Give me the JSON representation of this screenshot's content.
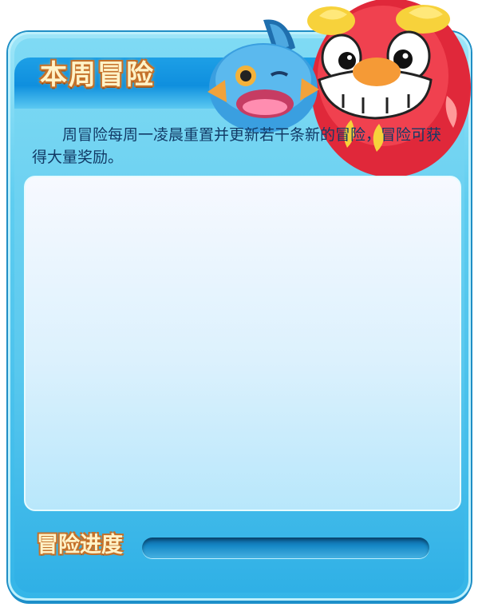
{
  "panel": {
    "title": "本周冒险",
    "description": "周冒险每周一凌晨重置并更新若干条新的冒险，冒险可获得大量奖励。"
  },
  "progress": {
    "label": "冒险进度",
    "value": 0
  },
  "mascots": {
    "left": "blue-fish-mascot",
    "right": "red-round-mascot"
  },
  "colors": {
    "panel_blue": "#34b5e8",
    "header_blue": "#0f8fde",
    "title_text": "#fff3c8",
    "title_outline": "#c4712a",
    "body_text": "#123a66"
  }
}
